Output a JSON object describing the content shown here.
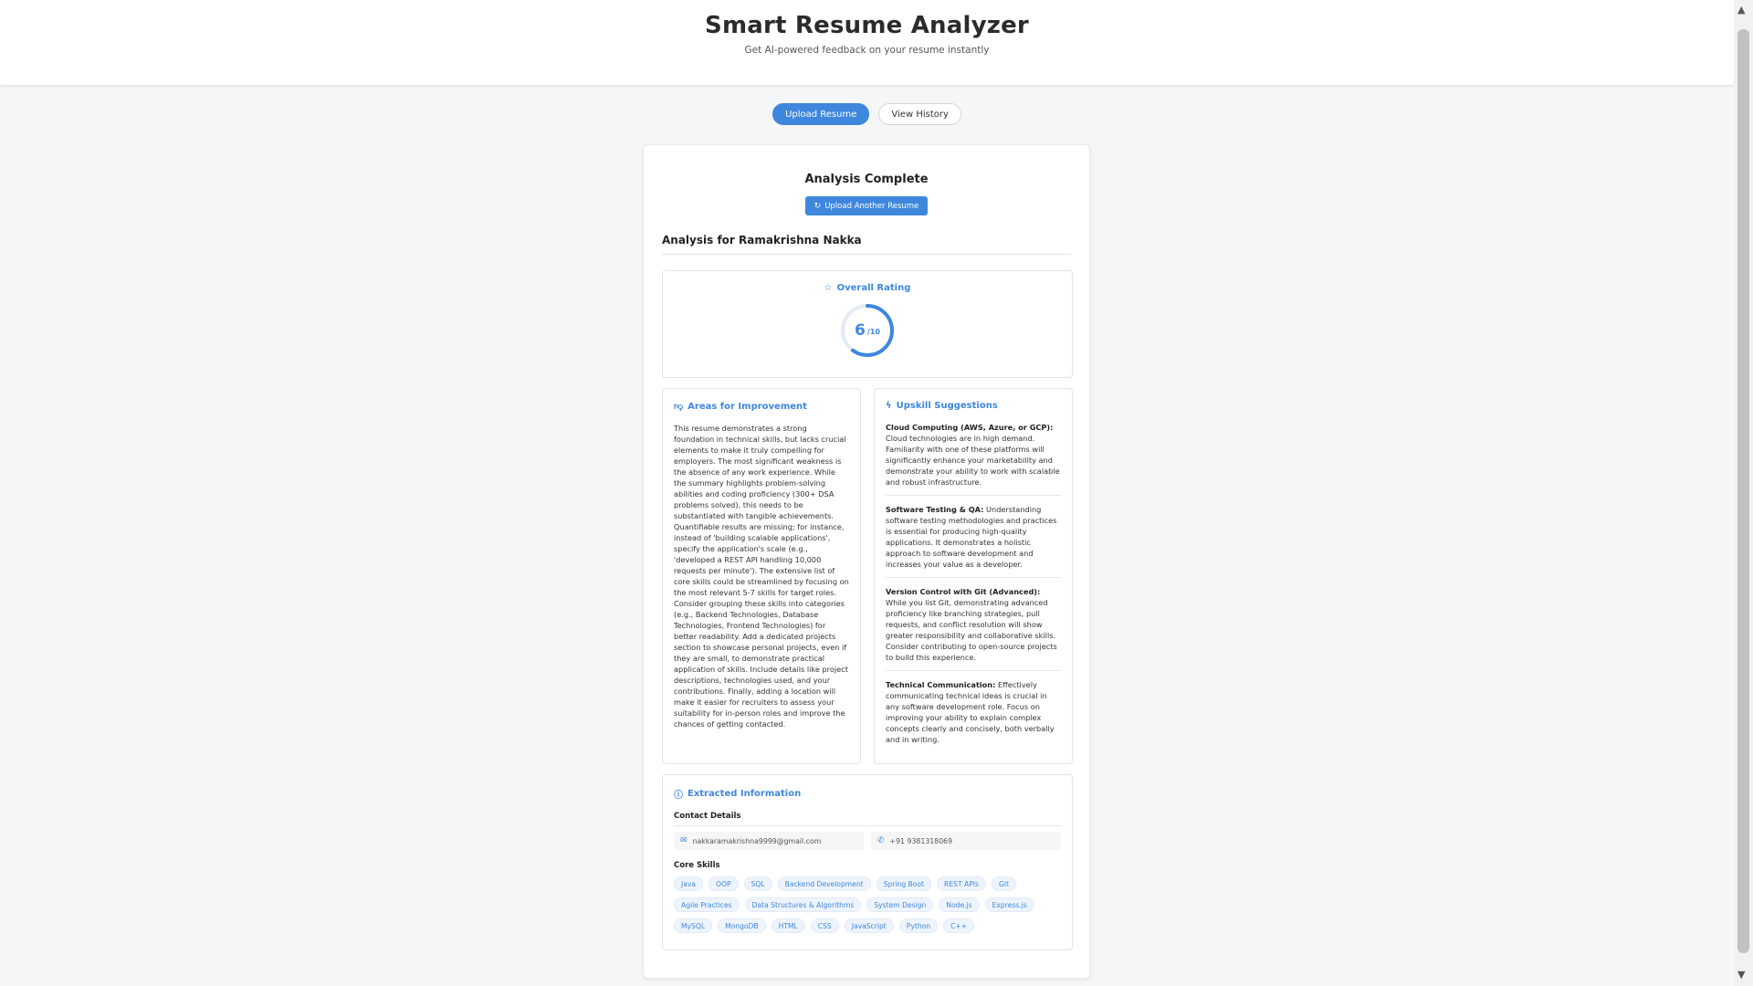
{
  "header": {
    "title": "Smart Resume Analyzer",
    "subtitle": "Get AI-powered feedback on your resume instantly"
  },
  "nav": {
    "upload_label": "Upload Resume",
    "history_label": "View History"
  },
  "result": {
    "complete_title": "Analysis Complete",
    "upload_another_label": "Upload Another Resume",
    "analysis_for": "Analysis for Ramakrishna Nakka"
  },
  "rating": {
    "heading": "Overall Rating",
    "score": "6",
    "out_of": "/10",
    "fraction": 0.6
  },
  "improvement": {
    "heading": "Areas for Improvement",
    "text": "This resume demonstrates a strong foundation in technical skills, but lacks crucial elements to make it truly compelling for employers. The most significant weakness is the absence of any work experience. While the summary highlights problem-solving abilities and coding proficiency (300+ DSA problems solved), this needs to be substantiated with tangible achievements. Quantifiable results are missing; for instance, instead of 'building scalable applications', specify the application's scale (e.g., 'developed a REST API handling 10,000 requests per minute'). The extensive list of core skills could be streamlined by focusing on the most relevant 5-7 skills for target roles. Consider grouping these skills into categories (e.g., Backend Technologies, Database Technologies, Frontend Technologies) for better readability. Add a dedicated projects section to showcase personal projects, even if they are small, to demonstrate practical application of skills. Include details like project descriptions, technologies used, and your contributions. Finally, adding a location will make it easier for recruiters to assess your suitability for in-person roles and improve the chances of getting contacted."
  },
  "upskill": {
    "heading": "Upskill Suggestions",
    "items": [
      {
        "title": "Cloud Computing (AWS, Azure, or GCP):",
        "text": " Cloud technologies are in high demand. Familiarity with one of these platforms will significantly enhance your marketability and demonstrate your ability to work with scalable and robust infrastructure."
      },
      {
        "title": "Software Testing & QA:",
        "text": " Understanding software testing methodologies and practices is essential for producing high-quality applications. It demonstrates a holistic approach to software development and increases your value as a developer."
      },
      {
        "title": "Version Control with Git (Advanced):",
        "text": " While you list Git, demonstrating advanced proficiency like branching strategies, pull requests, and conflict resolution will show greater responsibility and collaborative skills. Consider contributing to open-source projects to build this experience."
      },
      {
        "title": "Technical Communication:",
        "text": " Effectively communicating technical ideas is crucial in any software development role. Focus on improving your ability to explain complex concepts clearly and concisely, both verbally and in writing."
      }
    ]
  },
  "extracted": {
    "heading": "Extracted Information",
    "contact_heading": "Contact Details",
    "email": "nakkaramakrishna9999@gmail.com",
    "phone": "+91 9381318069",
    "skills_heading": "Core Skills",
    "skills": [
      "Java",
      "OOP",
      "SQL",
      "Backend Development",
      "Spring Boot",
      "REST APIs",
      "Git",
      "Agile Practices",
      "Data Structures & Algorithms",
      "System Design",
      "Node.js",
      "Express.js",
      "MySQL",
      "MongoDB",
      "HTML",
      "CSS",
      "JavaScript",
      "Python",
      "C++"
    ]
  },
  "colors": {
    "accent": "#3e87dd",
    "background": "#f5f6f8",
    "chip_bg": "#eef4fc"
  },
  "icons": {
    "rating": "star-icon",
    "improvement": "thumbs-down-icon",
    "upskill": "lightning-icon",
    "extracted": "info-icon",
    "email": "mail-icon",
    "phone": "phone-icon",
    "upload_another": "refresh-icon"
  }
}
